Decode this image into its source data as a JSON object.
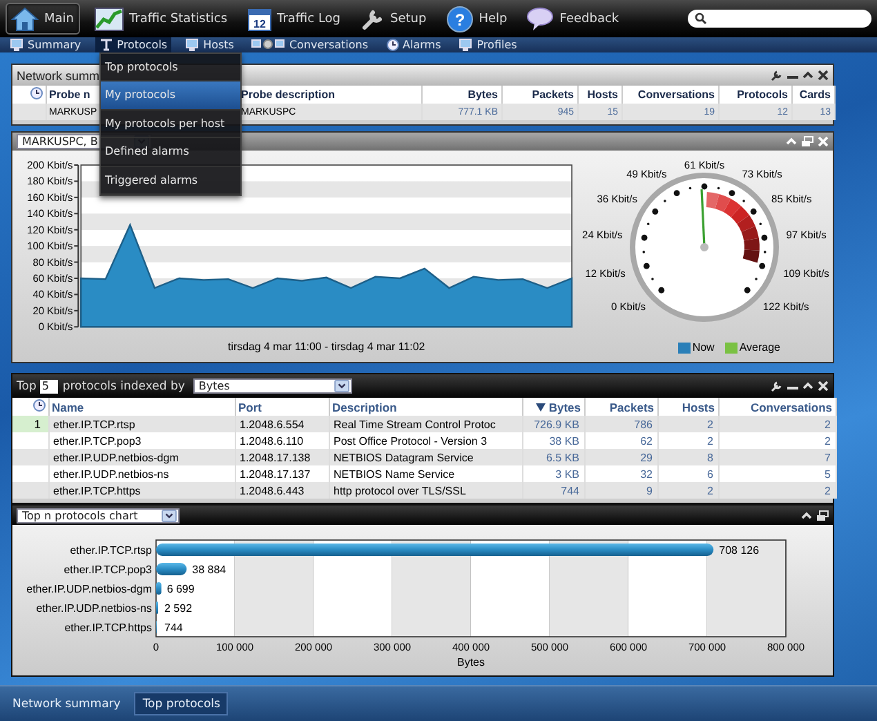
{
  "top_nav": {
    "items": [
      {
        "label": "Main",
        "selected": true
      },
      {
        "label": "Traffic Statistics",
        "selected": false
      },
      {
        "label": "Traffic Log",
        "selected": false,
        "icon_text": "12"
      },
      {
        "label": "Setup",
        "selected": false
      },
      {
        "label": "Help",
        "selected": false,
        "icon_text": "?"
      },
      {
        "label": "Feedback",
        "selected": false
      }
    ]
  },
  "sub_nav": {
    "items": [
      {
        "label": "Summary",
        "expanded": false
      },
      {
        "label": "Protocols",
        "expanded": true
      },
      {
        "label": "Hosts",
        "expanded": false
      },
      {
        "label": "Conversations",
        "expanded": false
      },
      {
        "label": "Alarms",
        "expanded": false
      },
      {
        "label": "Profiles",
        "expanded": false
      }
    ]
  },
  "protocols_menu": {
    "items": [
      {
        "label": "Top protocols",
        "selected": false
      },
      {
        "label": "My protocols",
        "selected": true
      },
      {
        "label": "My protocols per host",
        "selected": false
      },
      {
        "label": "Defined alarms",
        "selected": false
      },
      {
        "label": "Triggered alarms",
        "selected": false
      }
    ]
  },
  "network_summary": {
    "title": "Network summ",
    "columns": [
      "Probe n",
      "Probe description",
      "Bytes",
      "Packets",
      "Hosts",
      "Conversations",
      "Protocols",
      "Cards"
    ],
    "rows": [
      [
        "MARKUSP",
        "MARKUSPC",
        "777.1 KB",
        "945",
        "15",
        "19",
        "12",
        "13"
      ]
    ]
  },
  "traffic_panel": {
    "dropdown": "MARKUSPC, B",
    "chart_data": {
      "type": "area",
      "xlabel": "tirsdag 4 mar 11:00 - tirsdag 4 mar 11:02",
      "ylim": [
        0,
        200
      ],
      "yticks": [
        {
          "value": 0,
          "label": "0 Kbit/s"
        },
        {
          "value": 20,
          "label": "20 Kbit/s"
        },
        {
          "value": 40,
          "label": "40 Kbit/s"
        },
        {
          "value": 60,
          "label": "60 Kbit/s"
        },
        {
          "value": 80,
          "label": "80 Kbit/s"
        },
        {
          "value": 100,
          "label": "100 Kbit/s"
        },
        {
          "value": 120,
          "label": "120 Kbit/s"
        },
        {
          "value": 140,
          "label": "140 Kbit/s"
        },
        {
          "value": 160,
          "label": "160 Kbit/s"
        },
        {
          "value": 180,
          "label": "180 Kbit/s"
        },
        {
          "value": 200,
          "label": "200 Kbit/s"
        }
      ],
      "series": [
        {
          "color": "#2a8cc4",
          "values": [
            60,
            59,
            126,
            48,
            60,
            58,
            59,
            48,
            60,
            57,
            61,
            48,
            62,
            60,
            72,
            48,
            62,
            58,
            59,
            48,
            60
          ]
        }
      ]
    },
    "gauge": {
      "labels": [
        "61 Kbit/s",
        "49 Kbit/s",
        "73 Kbit/s",
        "36 Kbit/s",
        "85 Kbit/s",
        "24 Kbit/s",
        "97 Kbit/s",
        "12 Kbit/s",
        "109 Kbit/s",
        "0 Kbit/s",
        "122 Kbit/s"
      ],
      "level": 0.49
    },
    "legend": [
      {
        "label": "Now",
        "color": "#2a7fb8"
      },
      {
        "label": "Average",
        "color": "#7ac143"
      }
    ]
  },
  "top_protocols": {
    "prefix": "Top",
    "count": "5",
    "middle": "protocols indexed by",
    "index_by": "Bytes",
    "columns": [
      {
        "label": "Name",
        "sorted": false
      },
      {
        "label": "Port",
        "sorted": false
      },
      {
        "label": "Description",
        "sorted": false
      },
      {
        "label": "Bytes",
        "sorted": true
      },
      {
        "label": "Packets",
        "sorted": false
      },
      {
        "label": "Hosts",
        "sorted": false
      },
      {
        "label": "Conversations",
        "sorted": false
      }
    ],
    "rows": [
      {
        "rank": "1",
        "selected": true,
        "cells": [
          "ether.IP.TCP.rtsp",
          "1.2048.6.554",
          "Real Time Stream Control Protoc",
          "726.9 KB",
          "786",
          "2",
          "2"
        ]
      },
      {
        "selected": false,
        "cells": [
          "ether.IP.TCP.pop3",
          "1.2048.6.110",
          "Post Office Protocol - Version 3",
          "38 KB",
          "62",
          "2",
          "2"
        ]
      },
      {
        "selected": false,
        "cells": [
          "ether.IP.UDP.netbios-dgm",
          "1.2048.17.138",
          "NETBIOS Datagram Service",
          "6.5 KB",
          "29",
          "8",
          "7"
        ]
      },
      {
        "selected": false,
        "cells": [
          "ether.IP.UDP.netbios-ns",
          "1.2048.17.137",
          "NETBIOS Name Service",
          "3 KB",
          "32",
          "6",
          "5"
        ]
      },
      {
        "selected": false,
        "cells": [
          "ether.IP.TCP.https",
          "1.2048.6.443",
          "http protocol over TLS/SSL",
          "744",
          "9",
          "2",
          "2"
        ]
      }
    ]
  },
  "chart_panel": {
    "dropdown": "Top n protocols chart",
    "chart_data": {
      "type": "bar",
      "orientation": "horizontal",
      "grid": true,
      "xlabel": "Bytes",
      "categories": [
        "ether.IP.TCP.rtsp",
        "ether.IP.TCP.pop3",
        "ether.IP.UDP.netbios-dgm",
        "ether.IP.UDP.netbios-ns",
        "ether.IP.TCP.https"
      ],
      "values": [
        708126,
        38884,
        6699,
        2592,
        744
      ],
      "value_labels": [
        "708 126",
        "38 884",
        "6 699",
        "2 592",
        "744"
      ],
      "xlim": [
        0,
        800000
      ],
      "xticks": [
        {
          "value": 0,
          "label": "0"
        },
        {
          "value": 100000,
          "label": "100 000"
        },
        {
          "value": 200000,
          "label": "200 000"
        },
        {
          "value": 300000,
          "label": "300 000"
        },
        {
          "value": 400000,
          "label": "400 000"
        },
        {
          "value": 500000,
          "label": "500 000"
        },
        {
          "value": 600000,
          "label": "600 000"
        },
        {
          "value": 700000,
          "label": "700 000"
        },
        {
          "value": 800000,
          "label": "800 000"
        }
      ]
    }
  },
  "taskbar": {
    "items": [
      {
        "label": "Network summary",
        "selected": false
      },
      {
        "label": "Top protocols",
        "selected": true
      }
    ]
  }
}
